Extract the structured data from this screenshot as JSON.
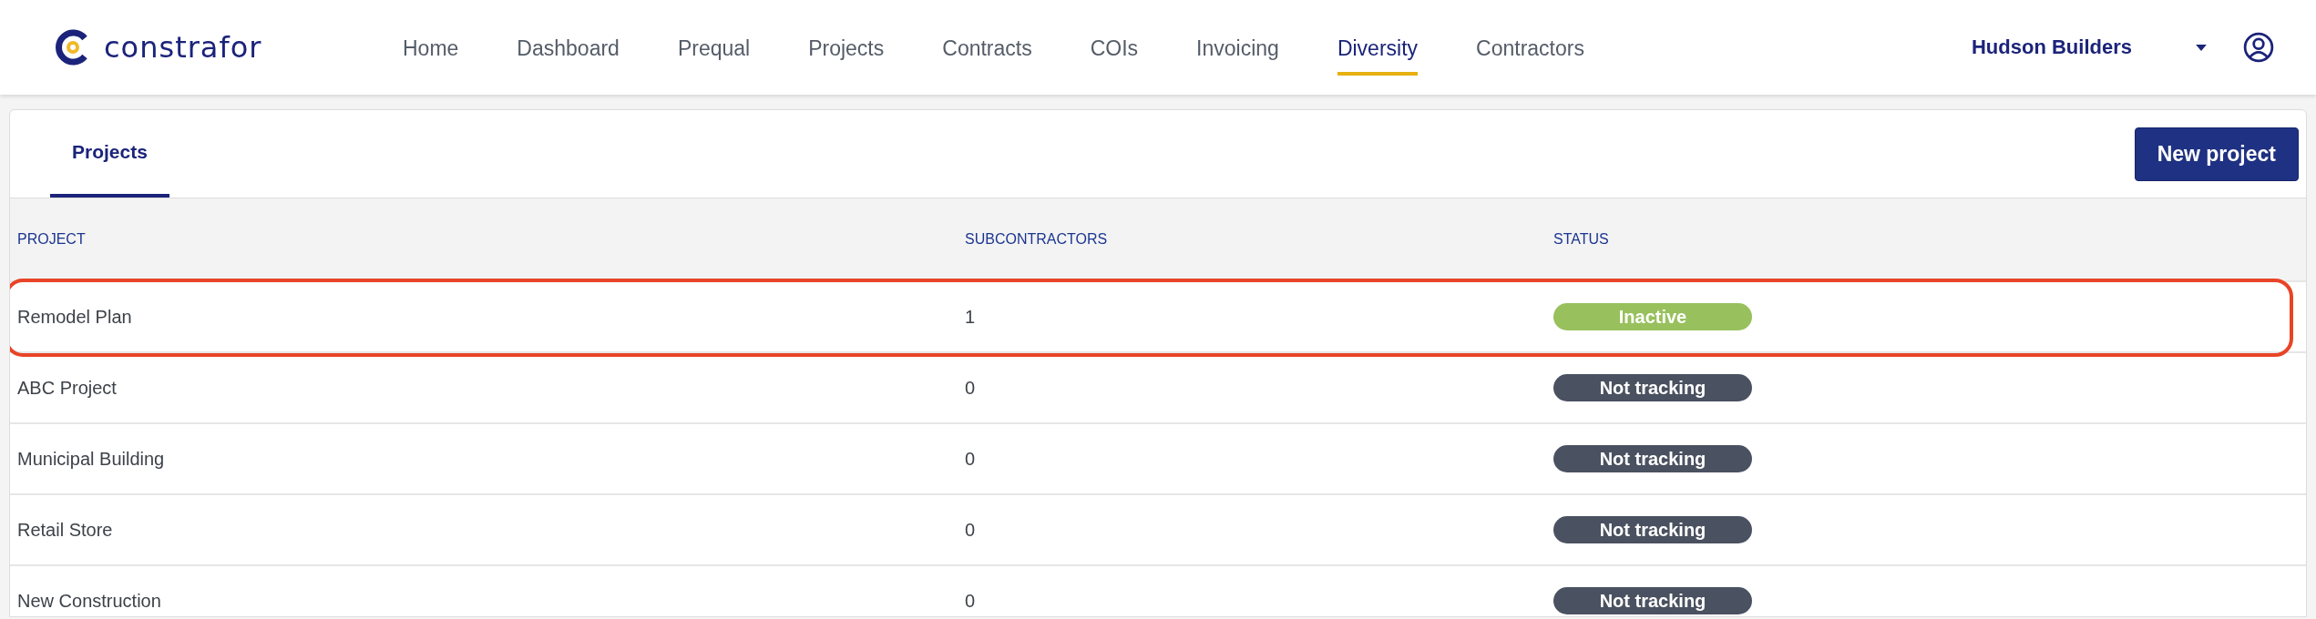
{
  "header": {
    "logo_text": "constrafor",
    "nav": [
      {
        "label": "Home",
        "selected": false
      },
      {
        "label": "Dashboard",
        "selected": false
      },
      {
        "label": "Prequal",
        "selected": false
      },
      {
        "label": "Projects",
        "selected": false
      },
      {
        "label": "Contracts",
        "selected": false
      },
      {
        "label": "COIs",
        "selected": false
      },
      {
        "label": "Invoicing",
        "selected": false
      },
      {
        "label": "Diversity",
        "selected": true
      },
      {
        "label": "Contractors",
        "selected": false
      }
    ],
    "company": "Hudson Builders"
  },
  "tabs": [
    {
      "label": "Projects",
      "selected": true
    }
  ],
  "new_project_button": "New project",
  "table": {
    "columns": [
      "PROJECT",
      "SUBCONTRACTORS",
      "STATUS"
    ],
    "rows": [
      {
        "project": "Remodel Plan",
        "subcontractors": "1",
        "status": {
          "label": "Inactive",
          "color": "#98c05c"
        },
        "highlighted": true
      },
      {
        "project": "ABC Project",
        "subcontractors": "0",
        "status": {
          "label": "Not tracking",
          "color": "#4a5160"
        },
        "highlighted": false
      },
      {
        "project": "Municipal Building",
        "subcontractors": "0",
        "status": {
          "label": "Not tracking",
          "color": "#4a5160"
        },
        "highlighted": false
      },
      {
        "project": "Retail Store",
        "subcontractors": "0",
        "status": {
          "label": "Not tracking",
          "color": "#4a5160"
        },
        "highlighted": false
      },
      {
        "project": "New Construction",
        "subcontractors": "0",
        "status": {
          "label": "Not tracking",
          "color": "#4a5160"
        },
        "highlighted": false
      }
    ]
  }
}
